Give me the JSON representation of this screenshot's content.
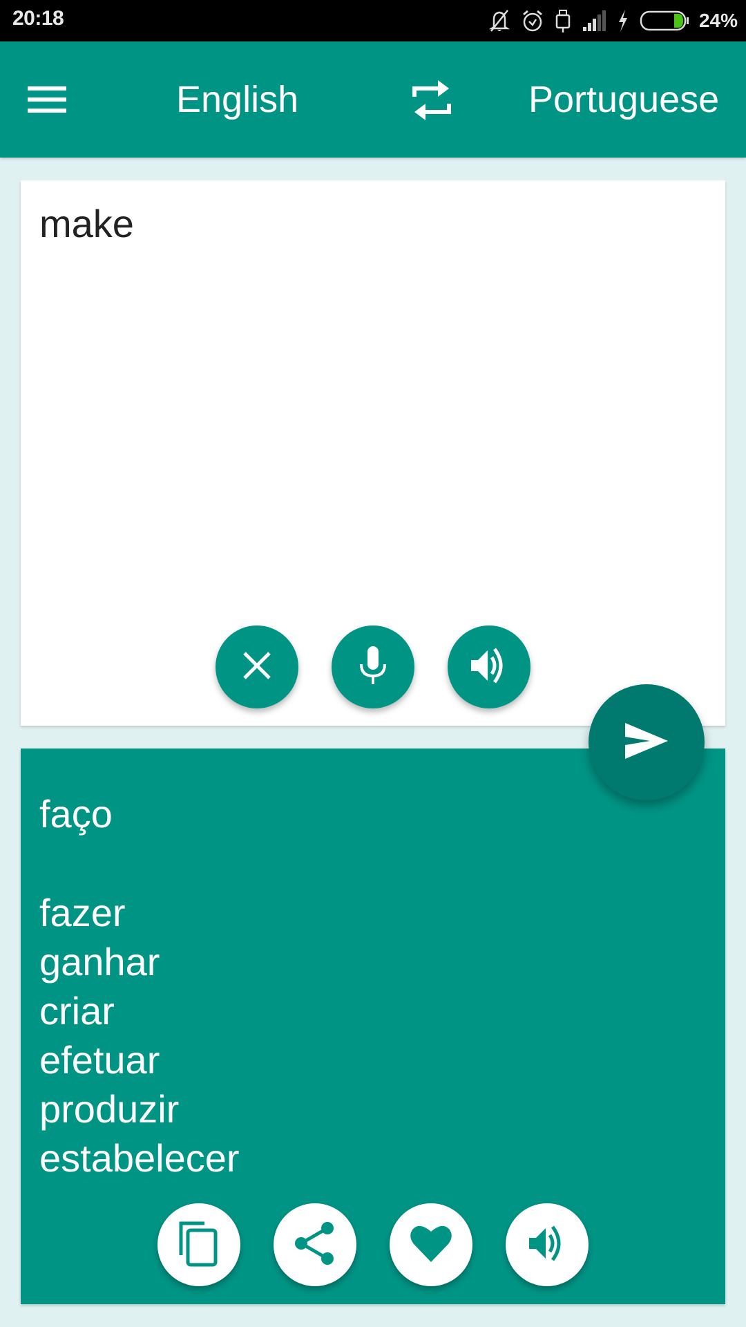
{
  "status_bar": {
    "time": "20:18",
    "icons": [
      "notifications-off-icon",
      "alarm-icon",
      "usb-icon",
      "signal-icon",
      "charging-icon",
      "battery-icon"
    ],
    "battery_percent": "24%",
    "battery_level": 0.24,
    "battery_color": "#4cc417"
  },
  "app_bar": {
    "menu_icon": "hamburger-menu-icon",
    "source_language": "English",
    "swap_icon": "swap-languages-icon",
    "target_language": "Portuguese",
    "background_color": "#009485"
  },
  "input": {
    "text": "make",
    "buttons": [
      {
        "name": "clear",
        "icon": "close-icon"
      },
      {
        "name": "voice-input",
        "icon": "microphone-icon"
      },
      {
        "name": "speak-input",
        "icon": "speaker-icon"
      }
    ]
  },
  "send_button": {
    "icon": "send-icon",
    "color": "#007a6e"
  },
  "output": {
    "primary_translation": "faço",
    "alternatives": [
      "fazer",
      "ganhar",
      "criar",
      "efetuar",
      "produzir",
      "estabelecer"
    ],
    "buttons": [
      {
        "name": "copy",
        "icon": "copy-icon"
      },
      {
        "name": "share",
        "icon": "share-icon"
      },
      {
        "name": "favorite",
        "icon": "heart-icon"
      },
      {
        "name": "speak-output",
        "icon": "speaker-icon"
      }
    ]
  }
}
